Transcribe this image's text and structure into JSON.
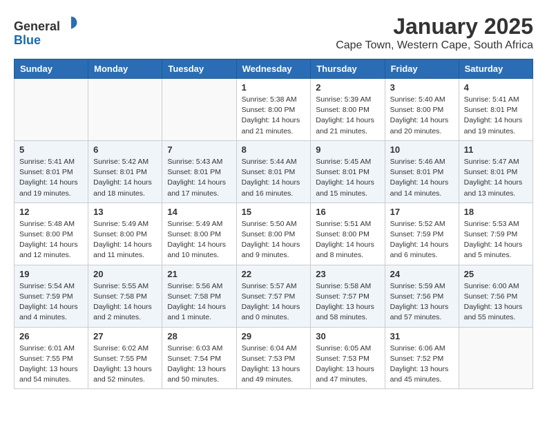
{
  "logo": {
    "general": "General",
    "blue": "Blue"
  },
  "header": {
    "month": "January 2025",
    "location": "Cape Town, Western Cape, South Africa"
  },
  "weekdays": [
    "Sunday",
    "Monday",
    "Tuesday",
    "Wednesday",
    "Thursday",
    "Friday",
    "Saturday"
  ],
  "weeks": [
    [
      {
        "day": "",
        "info": ""
      },
      {
        "day": "",
        "info": ""
      },
      {
        "day": "",
        "info": ""
      },
      {
        "day": "1",
        "info": "Sunrise: 5:38 AM\nSunset: 8:00 PM\nDaylight: 14 hours\nand 21 minutes."
      },
      {
        "day": "2",
        "info": "Sunrise: 5:39 AM\nSunset: 8:00 PM\nDaylight: 14 hours\nand 21 minutes."
      },
      {
        "day": "3",
        "info": "Sunrise: 5:40 AM\nSunset: 8:00 PM\nDaylight: 14 hours\nand 20 minutes."
      },
      {
        "day": "4",
        "info": "Sunrise: 5:41 AM\nSunset: 8:01 PM\nDaylight: 14 hours\nand 19 minutes."
      }
    ],
    [
      {
        "day": "5",
        "info": "Sunrise: 5:41 AM\nSunset: 8:01 PM\nDaylight: 14 hours\nand 19 minutes."
      },
      {
        "day": "6",
        "info": "Sunrise: 5:42 AM\nSunset: 8:01 PM\nDaylight: 14 hours\nand 18 minutes."
      },
      {
        "day": "7",
        "info": "Sunrise: 5:43 AM\nSunset: 8:01 PM\nDaylight: 14 hours\nand 17 minutes."
      },
      {
        "day": "8",
        "info": "Sunrise: 5:44 AM\nSunset: 8:01 PM\nDaylight: 14 hours\nand 16 minutes."
      },
      {
        "day": "9",
        "info": "Sunrise: 5:45 AM\nSunset: 8:01 PM\nDaylight: 14 hours\nand 15 minutes."
      },
      {
        "day": "10",
        "info": "Sunrise: 5:46 AM\nSunset: 8:01 PM\nDaylight: 14 hours\nand 14 minutes."
      },
      {
        "day": "11",
        "info": "Sunrise: 5:47 AM\nSunset: 8:01 PM\nDaylight: 14 hours\nand 13 minutes."
      }
    ],
    [
      {
        "day": "12",
        "info": "Sunrise: 5:48 AM\nSunset: 8:00 PM\nDaylight: 14 hours\nand 12 minutes."
      },
      {
        "day": "13",
        "info": "Sunrise: 5:49 AM\nSunset: 8:00 PM\nDaylight: 14 hours\nand 11 minutes."
      },
      {
        "day": "14",
        "info": "Sunrise: 5:49 AM\nSunset: 8:00 PM\nDaylight: 14 hours\nand 10 minutes."
      },
      {
        "day": "15",
        "info": "Sunrise: 5:50 AM\nSunset: 8:00 PM\nDaylight: 14 hours\nand 9 minutes."
      },
      {
        "day": "16",
        "info": "Sunrise: 5:51 AM\nSunset: 8:00 PM\nDaylight: 14 hours\nand 8 minutes."
      },
      {
        "day": "17",
        "info": "Sunrise: 5:52 AM\nSunset: 7:59 PM\nDaylight: 14 hours\nand 6 minutes."
      },
      {
        "day": "18",
        "info": "Sunrise: 5:53 AM\nSunset: 7:59 PM\nDaylight: 14 hours\nand 5 minutes."
      }
    ],
    [
      {
        "day": "19",
        "info": "Sunrise: 5:54 AM\nSunset: 7:59 PM\nDaylight: 14 hours\nand 4 minutes."
      },
      {
        "day": "20",
        "info": "Sunrise: 5:55 AM\nSunset: 7:58 PM\nDaylight: 14 hours\nand 2 minutes."
      },
      {
        "day": "21",
        "info": "Sunrise: 5:56 AM\nSunset: 7:58 PM\nDaylight: 14 hours\nand 1 minute."
      },
      {
        "day": "22",
        "info": "Sunrise: 5:57 AM\nSunset: 7:57 PM\nDaylight: 14 hours\nand 0 minutes."
      },
      {
        "day": "23",
        "info": "Sunrise: 5:58 AM\nSunset: 7:57 PM\nDaylight: 13 hours\nand 58 minutes."
      },
      {
        "day": "24",
        "info": "Sunrise: 5:59 AM\nSunset: 7:56 PM\nDaylight: 13 hours\nand 57 minutes."
      },
      {
        "day": "25",
        "info": "Sunrise: 6:00 AM\nSunset: 7:56 PM\nDaylight: 13 hours\nand 55 minutes."
      }
    ],
    [
      {
        "day": "26",
        "info": "Sunrise: 6:01 AM\nSunset: 7:55 PM\nDaylight: 13 hours\nand 54 minutes."
      },
      {
        "day": "27",
        "info": "Sunrise: 6:02 AM\nSunset: 7:55 PM\nDaylight: 13 hours\nand 52 minutes."
      },
      {
        "day": "28",
        "info": "Sunrise: 6:03 AM\nSunset: 7:54 PM\nDaylight: 13 hours\nand 50 minutes."
      },
      {
        "day": "29",
        "info": "Sunrise: 6:04 AM\nSunset: 7:53 PM\nDaylight: 13 hours\nand 49 minutes."
      },
      {
        "day": "30",
        "info": "Sunrise: 6:05 AM\nSunset: 7:53 PM\nDaylight: 13 hours\nand 47 minutes."
      },
      {
        "day": "31",
        "info": "Sunrise: 6:06 AM\nSunset: 7:52 PM\nDaylight: 13 hours\nand 45 minutes."
      },
      {
        "day": "",
        "info": ""
      }
    ]
  ]
}
